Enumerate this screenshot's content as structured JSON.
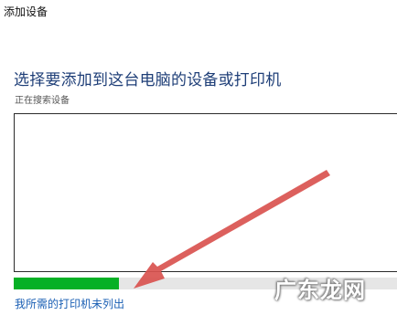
{
  "window": {
    "title": "添加设备"
  },
  "main": {
    "heading": "选择要添加到这台电脑的设备或打印机",
    "status": "正在搜索设备",
    "progress_fraction": 0.27,
    "progress_color": "#06b025",
    "printer_not_listed_link": "我所需的打印机未列出"
  },
  "overlay": {
    "arrow_color": "#d9534f",
    "watermark_text": "广东龙网"
  }
}
